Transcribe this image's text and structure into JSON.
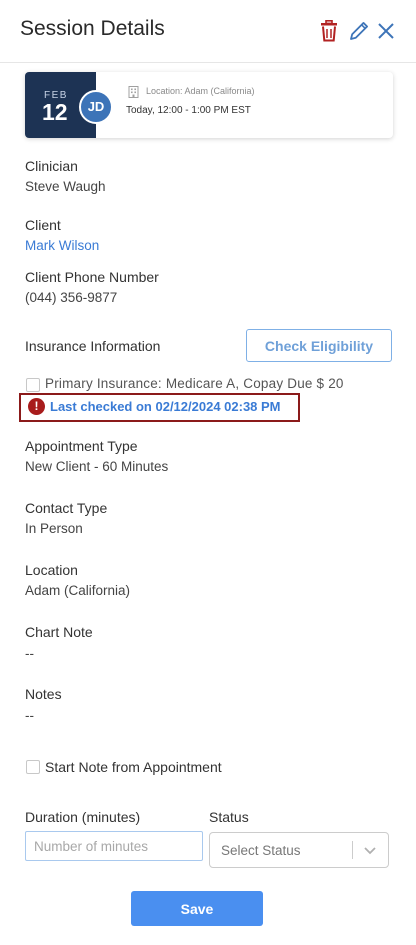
{
  "header": {
    "title": "Session Details",
    "icons": [
      "trash-icon",
      "pencil-icon",
      "close-icon"
    ],
    "trash_color": "#b22222",
    "accent_color": "#3d74b8"
  },
  "session_card": {
    "month": "FEB",
    "day": "12",
    "avatar_initials": "JD",
    "location": "Location: Adam (California)",
    "time": "Today, 12:00 - 1:00 PM EST"
  },
  "clinician": {
    "label": "Clinician",
    "value": "Steve Waugh"
  },
  "client": {
    "label": "Client",
    "value": "Mark Wilson"
  },
  "client_phone": {
    "label": "Client Phone Number",
    "value": "(044) 356-9877"
  },
  "insurance": {
    "label": "Insurance Information",
    "check_button": "Check Eligibility",
    "primary": "Primary Insurance: Medicare A, Copay Due $ 20",
    "last_checked": "Last checked on 02/12/2024 02:38 PM",
    "warning_icon": "!"
  },
  "appointment_type": {
    "label": "Appointment Type",
    "value": "New Client - 60 Minutes"
  },
  "contact_type": {
    "label": "Contact Type",
    "value": "In Person"
  },
  "location": {
    "label": "Location",
    "value": "Adam (California)"
  },
  "chart_note": {
    "label": "Chart Note",
    "value": "--"
  },
  "notes": {
    "label": "Notes",
    "value": "--"
  },
  "start_note": {
    "label": "Start Note from Appointment"
  },
  "duration": {
    "label": "Duration (minutes)",
    "placeholder": "Number of minutes"
  },
  "status": {
    "label": "Status",
    "placeholder": "Select Status"
  },
  "save_button": "Save",
  "colors": {
    "date_bg": "#1d3354",
    "link": "#3a7bd5",
    "warning": "#a81c1c",
    "primary_button": "#4a8ff0"
  }
}
